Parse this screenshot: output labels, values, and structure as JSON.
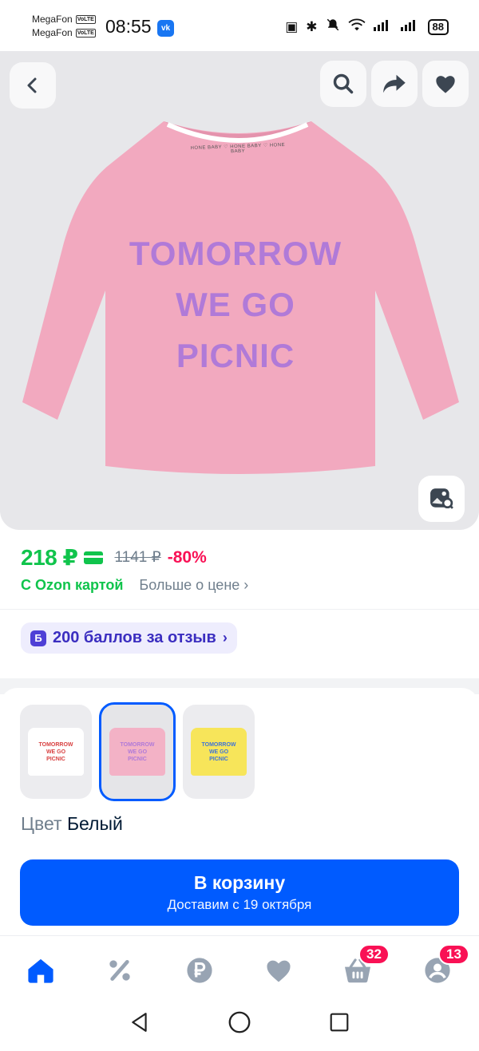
{
  "status_bar": {
    "carrier1": "MegaFon",
    "carrier2": "MegaFon",
    "volte": "VoLTE",
    "time": "08:55",
    "vk_icon": "vk-icon",
    "battery": "88"
  },
  "product_image": {
    "print_lines": [
      "TOMORROW",
      "WE GO",
      "PICNIC"
    ],
    "collar_text": "HONE BABY  ♡  HONE BABY  ♡  HONE BABY",
    "shirt_color": "#f2a9bf",
    "print_color": "#b07ad8"
  },
  "price": {
    "current": "218 ₽",
    "old": "1141 ₽",
    "discount": "-80%",
    "ozon_card_label": "С Ozon картой",
    "more_label": "Больше о цене",
    "green": "#10c44c",
    "pink": "#f91155"
  },
  "bonus": {
    "badge": "Б",
    "text": "200 баллов за отзыв"
  },
  "variants": [
    {
      "name": "white",
      "bg": "#ffffff",
      "text_color": "#d84040",
      "lines": [
        "TOMORROW",
        "WE GO",
        "PICNIC"
      ],
      "selected": false
    },
    {
      "name": "pink",
      "bg": "#f3b2c6",
      "text_color": "#b07ad8",
      "lines": [
        "TOMORROW",
        "WE GO",
        "PICNIC"
      ],
      "selected": true
    },
    {
      "name": "yellow",
      "bg": "#f7e55a",
      "text_color": "#3f74d8",
      "lines": [
        "TOMORROW",
        "WE GO",
        "PICNIC"
      ],
      "selected": false
    }
  ],
  "color": {
    "label": "Цвет",
    "value": "Белый"
  },
  "cta": {
    "title": "В корзину",
    "subtitle": "Доставим с 19 октября",
    "color": "#005bff"
  },
  "tabbar": {
    "items": [
      {
        "icon": "home-icon",
        "active": true
      },
      {
        "icon": "percent-icon",
        "active": false
      },
      {
        "icon": "ruble-icon",
        "active": false
      },
      {
        "icon": "heart-icon",
        "active": false
      },
      {
        "icon": "cart-icon",
        "badge": "32",
        "active": false
      },
      {
        "icon": "profile-icon",
        "badge": "13",
        "active": false
      }
    ]
  }
}
